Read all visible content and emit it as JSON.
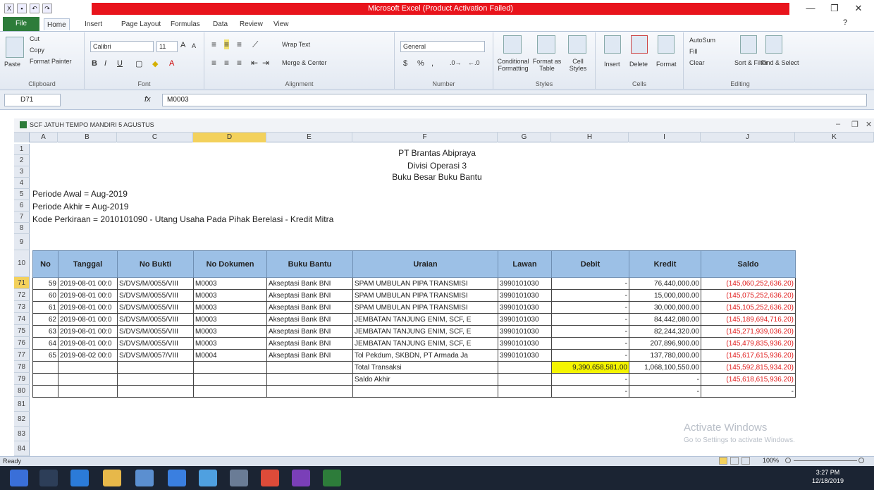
{
  "window": {
    "title": "Microsoft Excel (Product Activation Failed)",
    "minimize": "—",
    "restore": "❐",
    "close": "✕"
  },
  "ribbon": {
    "tabs": [
      "File",
      "Home",
      "Insert",
      "Page Layout",
      "Formulas",
      "Data",
      "Review",
      "View"
    ],
    "clipboard": {
      "paste": "Paste",
      "cut": "Cut",
      "copy": "Copy",
      "format_painter": "Format Painter",
      "label": "Clipboard"
    },
    "font": {
      "name": "Calibri",
      "size": "11",
      "label": "Font"
    },
    "alignment": {
      "wrap_text": "Wrap Text",
      "merge_center": "Merge & Center",
      "label": "Alignment"
    },
    "number": {
      "format": "General",
      "currency": "$",
      "percent": "%",
      "comma": ",",
      "label": "Number"
    },
    "styles": {
      "conditional": "Conditional Formatting",
      "format_table": "Format as Table",
      "cell_styles": "Cell Styles",
      "label": "Styles"
    },
    "cells": {
      "insert": "Insert",
      "delete": "Delete",
      "format": "Format",
      "label": "Cells"
    },
    "editing": {
      "autosum": "AutoSum",
      "fill": "Fill",
      "clear": "Clear",
      "sort_filter": "Sort & Filter",
      "find_select": "Find & Select",
      "label": "Editing"
    }
  },
  "formula_bar": {
    "name_box": "D71",
    "fx": "fx",
    "value": "M0003"
  },
  "workbook": {
    "title": "SCF JATUH TEMPO MANDIRI 5 AGUSTUS"
  },
  "columns": [
    "A",
    "B",
    "C",
    "D",
    "E",
    "F",
    "G",
    "H",
    "I",
    "J",
    "K"
  ],
  "rows": [
    "1",
    "2",
    "3",
    "4",
    "5",
    "6",
    "7",
    "8",
    "9",
    "10",
    "71",
    "72",
    "73",
    "74",
    "75",
    "76",
    "77",
    "78",
    "79",
    "80",
    "81",
    "82",
    "83",
    "84"
  ],
  "report": {
    "company": "PT Brantas Abipraya",
    "division": "Divisi Operasi 3",
    "book": "Buku Besar Buku Bantu",
    "periode_awal": "Periode Awal = Aug-2019",
    "periode_akhir": "Periode Akhir = Aug-2019",
    "kode": "Kode Perkiraan = 2010101090 - Utang Usaha Pada Pihak Berelasi - Kredit Mitra"
  },
  "table": {
    "headers": [
      "No",
      "Tanggal",
      "No Bukti",
      "No Dokumen",
      "Buku Bantu",
      "Uraian",
      "Lawan",
      "Debit",
      "Kredit",
      "Saldo"
    ],
    "rows": [
      [
        "59",
        "2019-08-01 00:0",
        "S/DVS/M/0055/VIII",
        "M0003",
        "Akseptasi Bank BNI",
        "SPAM UMBULAN PIPA TRANSMISI",
        "3990101030",
        "-",
        "76,440,000.00",
        "(145,060,252,636.20)"
      ],
      [
        "60",
        "2019-08-01 00:0",
        "S/DVS/M/0055/VIII",
        "M0003",
        "Akseptasi Bank BNI",
        "SPAM UMBULAN PIPA TRANSMISI",
        "3990101030",
        "-",
        "15,000,000.00",
        "(145,075,252,636.20)"
      ],
      [
        "61",
        "2019-08-01 00:0",
        "S/DVS/M/0055/VIII",
        "M0003",
        "Akseptasi Bank BNI",
        "SPAM UMBULAN PIPA TRANSMISI",
        "3990101030",
        "-",
        "30,000,000.00",
        "(145,105,252,636.20)"
      ],
      [
        "62",
        "2019-08-01 00:0",
        "S/DVS/M/0055/VIII",
        "M0003",
        "Akseptasi Bank BNI",
        "JEMBATAN TANJUNG ENIM, SCF, E",
        "3990101030",
        "-",
        "84,442,080.00",
        "(145,189,694,716.20)"
      ],
      [
        "63",
        "2019-08-01 00:0",
        "S/DVS/M/0055/VIII",
        "M0003",
        "Akseptasi Bank BNI",
        "JEMBATAN TANJUNG ENIM, SCF, E",
        "3990101030",
        "-",
        "82,244,320.00",
        "(145,271,939,036.20)"
      ],
      [
        "64",
        "2019-08-01 00:0",
        "S/DVS/M/0055/VIII",
        "M0003",
        "Akseptasi Bank BNI",
        "JEMBATAN TANJUNG ENIM, SCF, E",
        "3990101030",
        "-",
        "207,896,900.00",
        "(145,479,835,936.20)"
      ],
      [
        "65",
        "2019-08-02 00:0",
        "S/DVS/M/0057/VIII",
        "M0004",
        "Akseptasi Bank BNI",
        "Tol Pekdum, SKBDN, PT Armada Ja",
        "3990101030",
        "-",
        "137,780,000.00",
        "(145,617,615,936.20)"
      ]
    ],
    "total_label": "Total Transaksi",
    "total_debit": "9,390,658,581.00",
    "total_kredit": "1,068,100,550.00",
    "total_saldo": "(145,592,815,934.20)",
    "saldo_akhir_label": "Saldo Akhir",
    "saldo_akhir": "(145,618,615,936.20)",
    "dash": "-"
  },
  "status": {
    "ready": "Ready",
    "zoom": "100%"
  },
  "watermark": {
    "title": "Activate Windows",
    "sub": "Go to Settings to activate Windows."
  },
  "clock": {
    "time": "3:27 PM",
    "date": "12/18/2019"
  }
}
